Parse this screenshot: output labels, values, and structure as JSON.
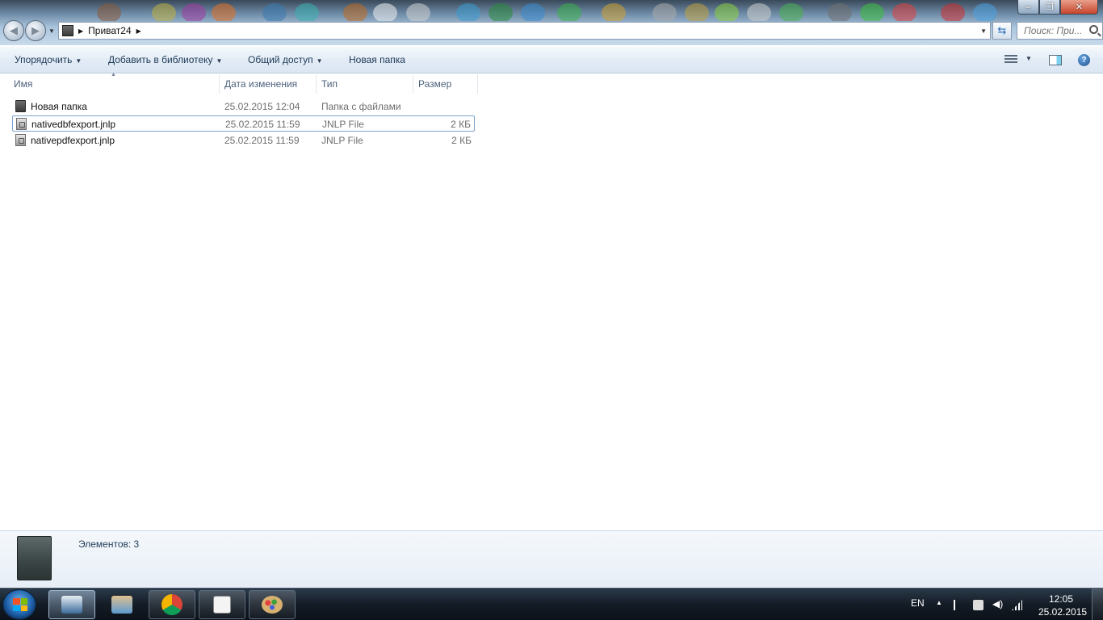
{
  "window": {
    "controls": {
      "minimize": "–",
      "maximize": "❐",
      "close": "✕"
    }
  },
  "address": {
    "crumbs": [
      "Приват24"
    ]
  },
  "search": {
    "placeholder": "Поиск: При..."
  },
  "toolbar": {
    "organize": "Упорядочить",
    "add_to_library": "Добавить в библиотеку",
    "share": "Общий доступ",
    "new_folder": "Новая папка"
  },
  "columns": {
    "name": "Имя",
    "date": "Дата изменения",
    "type": "Тип",
    "size": "Размер"
  },
  "files": [
    {
      "name": "Новая папка",
      "date": "25.02.2015 12:04",
      "type": "Папка с файлами",
      "size": "",
      "icon": "folder-icon"
    },
    {
      "name": "nativedbfexport.jnlp",
      "date": "25.02.2015 11:59",
      "type": "JNLP File",
      "size": "2 КБ",
      "icon": "jnlp-file-icon",
      "selected": true
    },
    {
      "name": "nativepdfexport.jnlp",
      "date": "25.02.2015 11:59",
      "type": "JNLP File",
      "size": "2 КБ",
      "icon": "jnlp-file-icon"
    }
  ],
  "details": {
    "count": "Элементов: 3"
  },
  "taskbar": {
    "language": "EN",
    "time": "12:05",
    "date": "25.02.2015",
    "pinned": [
      "explorer-icon",
      "downloads-icon",
      "chrome-icon",
      "tasks-icon",
      "paint-icon"
    ]
  },
  "colors": {
    "toolbar_text": "#1e3956",
    "selection_border": "#7da2ce",
    "secondary_text": "#6d6d6d"
  }
}
